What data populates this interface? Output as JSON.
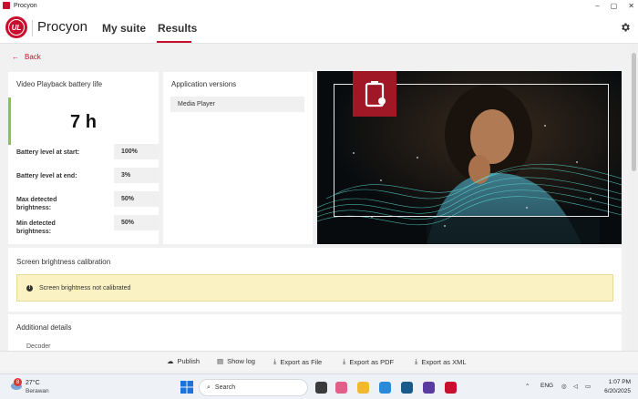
{
  "window": {
    "title": "Procyon",
    "controls": [
      "–",
      "▢",
      "✕"
    ]
  },
  "header": {
    "logo_text": "UL",
    "brand": "Procyon",
    "nav": [
      {
        "label": "My suite"
      },
      {
        "label": "Results",
        "active": true
      }
    ]
  },
  "back_label": "Back",
  "battery_card": {
    "title": "Video Playback battery life",
    "big_value": "7 h",
    "stats": [
      {
        "label": "Battery level at start:",
        "value": "100%"
      },
      {
        "label": "Battery level at end:",
        "value": "3%"
      },
      {
        "label": "Max detected brightness:",
        "value": "50%"
      },
      {
        "label": "Min detected brightness:",
        "value": "50%"
      }
    ]
  },
  "versions_card": {
    "title": "Application versions",
    "apps": [
      "Media Player"
    ]
  },
  "calibration": {
    "title": "Screen brightness calibration",
    "warning": "Screen brightness not calibrated"
  },
  "additional": {
    "title": "Additional details",
    "peek": "Decoder"
  },
  "actions": [
    {
      "label": "Publish",
      "icon": "cloud-upload-icon"
    },
    {
      "label": "Show log",
      "icon": "document-icon"
    },
    {
      "label": "Export as File",
      "icon": "download-icon"
    },
    {
      "label": "Export as PDF",
      "icon": "download-icon"
    },
    {
      "label": "Export as XML",
      "icon": "download-icon"
    }
  ],
  "taskbar": {
    "weather_badge": "8",
    "temperature": "27°C",
    "weather": "Berawan",
    "search_placeholder": "Search",
    "language": "ENG",
    "time": "1:07 PM",
    "date": "6/20/2025"
  },
  "colors": {
    "accent": "#c8102e",
    "success": "#8bc34a",
    "warning_bg": "#fbf2c4"
  }
}
